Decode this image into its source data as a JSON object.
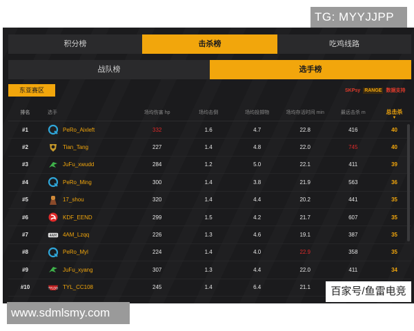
{
  "watermark_top": "TG: MYYJJPP",
  "watermark_bottom": "www.sdmlsmy.com",
  "attribution": "百家号/鱼雷电竞",
  "tabs": [
    {
      "label": "积分榜",
      "active": false
    },
    {
      "label": "击杀榜",
      "active": true
    },
    {
      "label": "吃鸡线路",
      "active": false
    }
  ],
  "subtabs": [
    {
      "label": "战队榜",
      "active": false
    },
    {
      "label": "选手榜",
      "active": true
    }
  ],
  "region_button": "东亚赛区",
  "sponsor": {
    "logo1": "SKPsy",
    "logo2": "RANGE",
    "text": "数据支持"
  },
  "table": {
    "headers": {
      "rank": "排名",
      "player": "选手",
      "avg_damage": "场均伤害 hp",
      "avg_kills": "场均击倒",
      "avg_drops": "场均投掷物",
      "avg_survival": "场均存活时间 min",
      "max_kills": "最远击杀 m",
      "total_kills": "总击杀"
    },
    "rows": [
      {
        "rank": "#1",
        "logo": "q-circle",
        "name": "PeRo_Aixleft",
        "damage": "332",
        "kills": "1.6",
        "drops": "4.7",
        "survival": "22.8",
        "max": "416",
        "total": "40",
        "damage_hl": true,
        "max_hl": false,
        "survival_hl": false
      },
      {
        "rank": "#2",
        "logo": "gold-badge",
        "name": "Tian_Tang",
        "damage": "227",
        "kills": "1.4",
        "drops": "4.8",
        "survival": "22.0",
        "max": "745",
        "total": "40",
        "damage_hl": false,
        "max_hl": true,
        "survival_hl": false
      },
      {
        "rank": "#3",
        "logo": "green-dragon",
        "name": "JuFu_xwudd",
        "damage": "284",
        "kills": "1.2",
        "drops": "5.0",
        "survival": "22.1",
        "max": "411",
        "total": "39",
        "damage_hl": false,
        "max_hl": false,
        "survival_hl": false
      },
      {
        "rank": "#4",
        "logo": "q-circle",
        "name": "PeRo_Ming",
        "damage": "300",
        "kills": "1.4",
        "drops": "3.8",
        "survival": "21.9",
        "max": "563",
        "total": "36",
        "damage_hl": false,
        "max_hl": false,
        "survival_hl": false
      },
      {
        "rank": "#5",
        "logo": "figure",
        "name": "17_shou",
        "damage": "320",
        "kills": "1.4",
        "drops": "4.4",
        "survival": "20.2",
        "max": "441",
        "total": "35",
        "damage_hl": false,
        "max_hl": false,
        "survival_hl": false
      },
      {
        "rank": "#6",
        "logo": "red-swirl",
        "name": "KDF_EEND",
        "damage": "299",
        "kills": "1.5",
        "drops": "4.2",
        "survival": "21.7",
        "max": "607",
        "total": "35",
        "damage_hl": false,
        "max_hl": false,
        "survival_hl": false
      },
      {
        "rank": "#7",
        "logo": "4am",
        "name": "4AM_Lzqq",
        "damage": "226",
        "kills": "1.3",
        "drops": "4.6",
        "survival": "19.1",
        "max": "387",
        "total": "35",
        "damage_hl": false,
        "max_hl": false,
        "survival_hl": false
      },
      {
        "rank": "#8",
        "logo": "q-circle",
        "name": "PeRo_Myl",
        "damage": "224",
        "kills": "1.4",
        "drops": "4.0",
        "survival": "22.9",
        "max": "358",
        "total": "35",
        "damage_hl": false,
        "max_hl": false,
        "survival_hl": true
      },
      {
        "rank": "#9",
        "logo": "green-dragon",
        "name": "JuFu_xyang",
        "damage": "307",
        "kills": "1.3",
        "drops": "4.4",
        "survival": "22.0",
        "max": "411",
        "total": "34",
        "damage_hl": false,
        "max_hl": false,
        "survival_hl": false
      },
      {
        "rank": "#10",
        "logo": "tylog",
        "name": "TYL_CC108",
        "damage": "245",
        "kills": "1.4",
        "drops": "6.4",
        "survival": "21.1",
        "max": "3",
        "total": "",
        "damage_hl": false,
        "max_hl": false,
        "survival_hl": false
      }
    ]
  },
  "colors": {
    "accent": "#f2a60c",
    "highlight_red": "#e02a2a",
    "background": "#1b1b1d"
  }
}
